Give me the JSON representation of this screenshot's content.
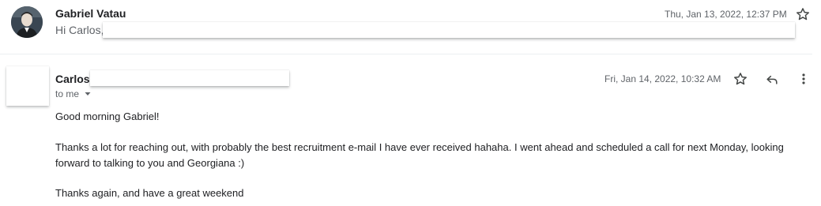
{
  "thread": [
    {
      "sender": "Gabriel Vatau",
      "snippet": "Hi Carlos,",
      "date": "Thu, Jan 13, 2022, 12:37 PM",
      "icons": {
        "avatar": "profile-photo",
        "star": "star-outline-icon"
      }
    },
    {
      "sender": "Carlos",
      "recipient": "to me",
      "date": "Fri, Jan 14, 2022, 10:32 AM",
      "icons": {
        "star": "star-outline-icon",
        "reply": "reply-icon",
        "more": "more-vert-icon",
        "recipient_dropdown": "caret-down-icon"
      },
      "body": {
        "greeting": "Good morning Gabriel!",
        "paragraph": "Thanks a lot for reaching out, with probably the best recruitment e-mail I have ever received hahaha. I went ahead and scheduled a call for next Monday, looking forward to talking to you and Georgiana :)",
        "closing": "Thanks again, and have a great weekend"
      }
    }
  ],
  "colors": {
    "text_primary": "#202124",
    "text_secondary": "#5f6368",
    "divider": "#eceff1"
  }
}
